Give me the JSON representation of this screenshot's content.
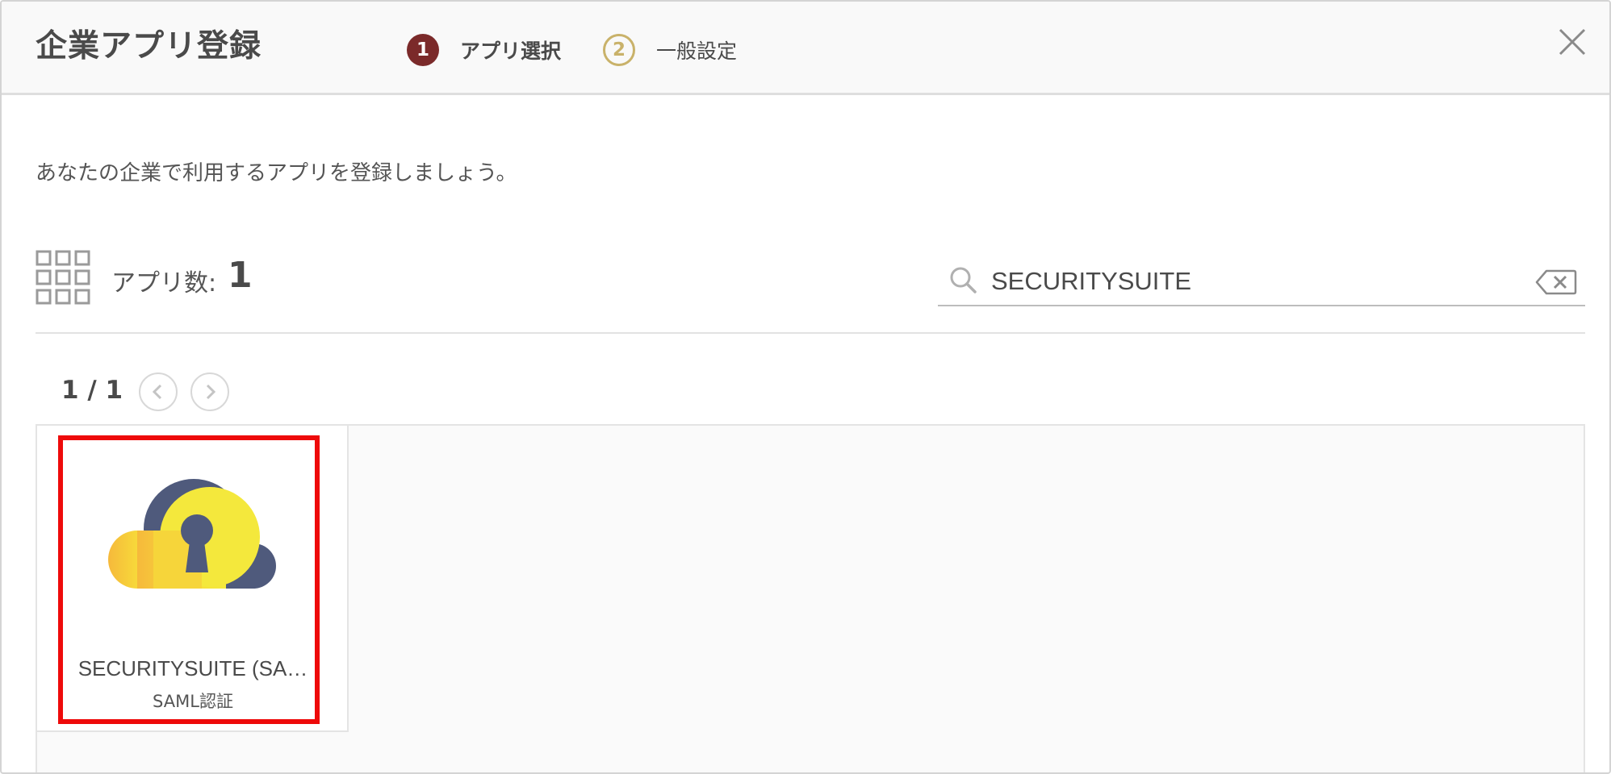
{
  "header": {
    "title": "企業アプリ登録",
    "steps": [
      {
        "number": "1",
        "label": "アプリ選択",
        "state": "active"
      },
      {
        "number": "2",
        "label": "一般設定",
        "state": "inactive"
      }
    ],
    "close_icon": "close-icon"
  },
  "intro": "あなたの企業で利用するアプリを登録しましょう。",
  "toolbar": {
    "count_label": "アプリ数:",
    "count_value": "1",
    "grid_icon": "grid-icon"
  },
  "search": {
    "value": "SECURITYSUITE",
    "icon": "search-icon",
    "clear_icon": "backspace-clear-icon"
  },
  "pager": {
    "text": "1 / 1",
    "prev_icon": "chevron-left-icon",
    "next_icon": "chevron-right-icon"
  },
  "apps": [
    {
      "name": "SECURITYSUITE (SA…",
      "auth": "SAML認証",
      "icon": "cloud-keyhole-logo",
      "highlighted": true
    }
  ],
  "colors": {
    "step_active": "#7b2a2a",
    "step_inactive": "#c9b26a",
    "highlight": "#ee0a0a",
    "logo_navy": "#4f5a7c",
    "logo_yellow": "#f7e43a"
  }
}
